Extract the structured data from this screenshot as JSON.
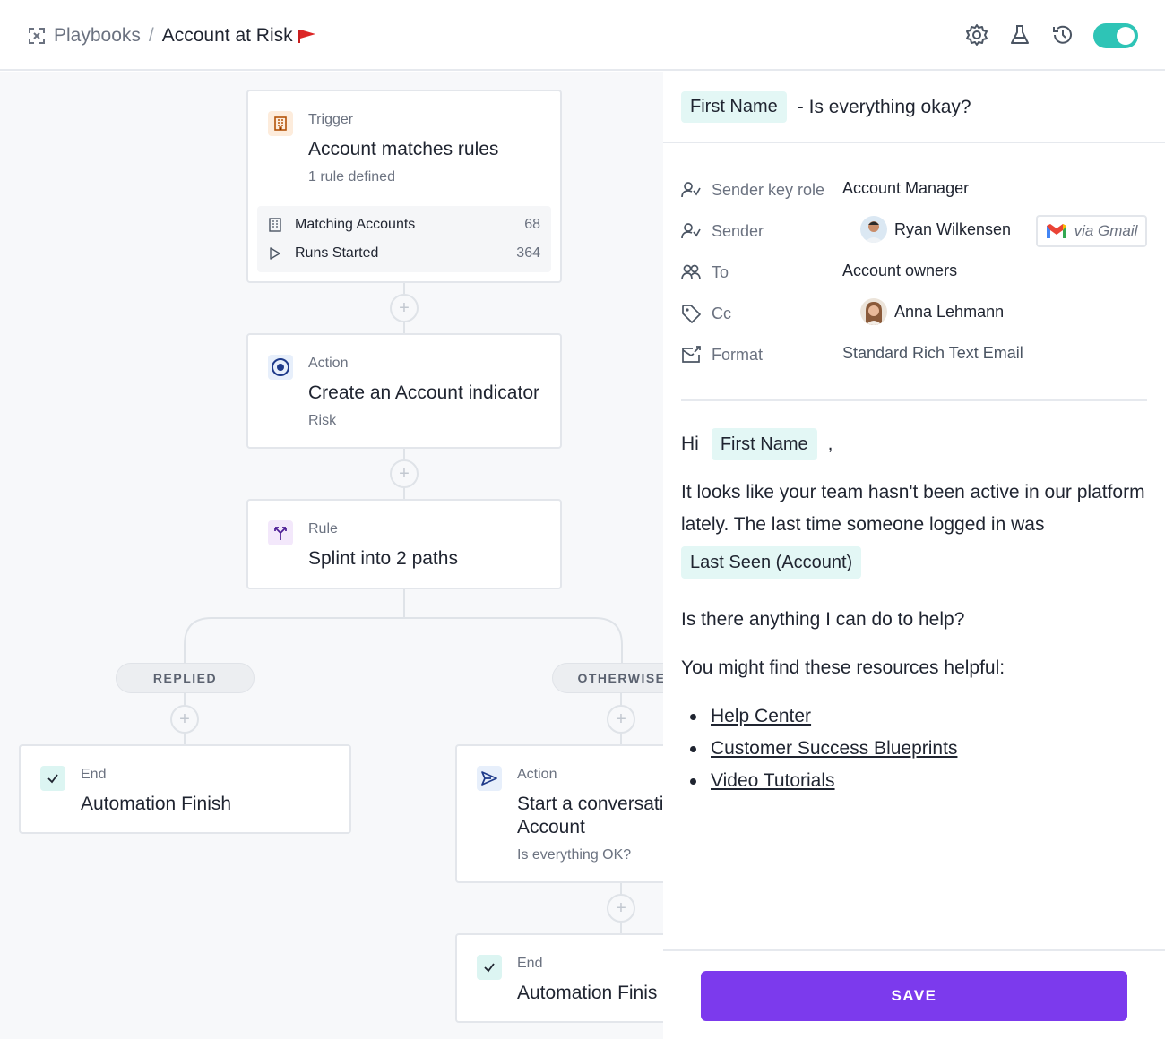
{
  "header": {
    "breadcrumb_root": "Playbooks",
    "breadcrumb_sep": "/",
    "breadcrumb_current": "Account at Risk",
    "toggle_on": true,
    "accent": "#2ec4b6"
  },
  "flow": {
    "trigger": {
      "type": "Trigger",
      "title": "Account matches rules",
      "subtitle": "1 rule defined",
      "stats": [
        {
          "label": "Matching Accounts",
          "value": "68"
        },
        {
          "label": "Runs Started",
          "value": "364"
        }
      ]
    },
    "action1": {
      "type": "Action",
      "title": "Create an Account indicator",
      "subtitle": "Risk"
    },
    "rule": {
      "type": "Rule",
      "title": "Splint into 2 paths"
    },
    "branch_left": "REPLIED",
    "branch_right": "OTHERWISE",
    "end_left": {
      "type": "End",
      "title": "Automation Finish"
    },
    "action2": {
      "type": "Action",
      "title_line1": "Start a conversati",
      "title_line2": "Account",
      "subtitle": "Is everything OK?"
    },
    "end_right": {
      "type": "End",
      "title": "Automation Finis"
    }
  },
  "email": {
    "subject_tag": "First Name",
    "subject_text": "- Is everything okay?",
    "fields": {
      "sender_key_role_label": "Sender key role",
      "sender_key_role_value": "Account Manager",
      "sender_label": "Sender",
      "sender_value": "Ryan Wilkensen",
      "via": "via Gmail",
      "to_label": "To",
      "to_value": "Account owners",
      "cc_label": "Cc",
      "cc_value": "Anna Lehmann",
      "format_label": "Format",
      "format_value": "Standard Rich Text Email"
    },
    "body": {
      "greeting": "Hi",
      "greeting_tag": "First Name",
      "greeting_comma": ",",
      "paragraph1": "It looks like your team hasn't been active in our platform lately. The last time someone logged in was",
      "last_seen_tag": "Last Seen (Account)",
      "paragraph2": "Is there anything I can do to help?",
      "paragraph3": "You might find these resources helpful:",
      "links": [
        "Help Center",
        "Customer Success Blueprints",
        "Video Tutorials"
      ]
    },
    "save_label": "SAVE",
    "save_color": "#7c3aed"
  }
}
